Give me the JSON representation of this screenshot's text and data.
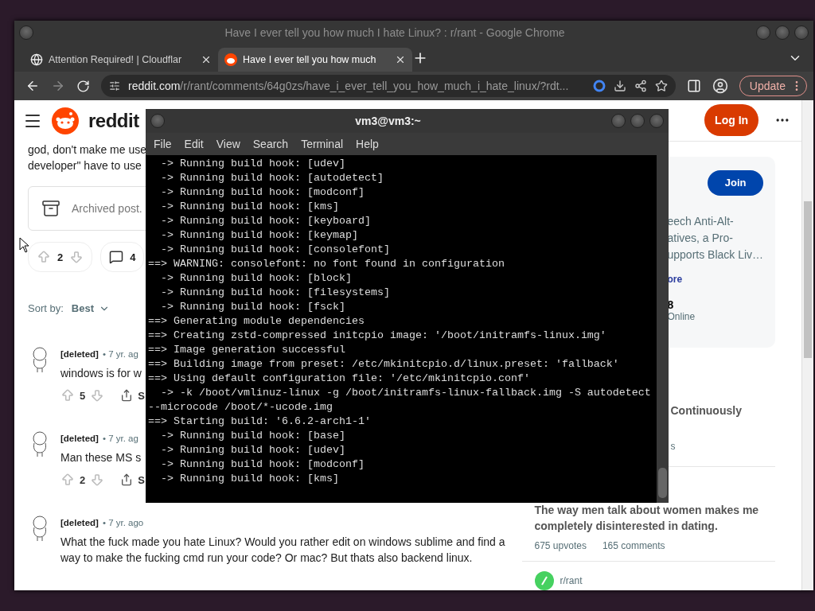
{
  "browser": {
    "title": "Have I ever tell you how much I hate Linux? : r/rant - Google Chrome",
    "tabs": [
      {
        "kind": "globe",
        "label": "Attention Required! | Cloudflar",
        "selected": false
      },
      {
        "kind": "reddit",
        "label": "Have I ever tell you how much",
        "selected": true
      }
    ],
    "url": {
      "host": "reddit.com",
      "path": "/r/rant/comments/64g0zs/have_i_ever_tell_you_how_much_i_hate_linux/?rdt..."
    },
    "update_label": "Update"
  },
  "reddit": {
    "logo": "reddit",
    "login": "Log In",
    "post": {
      "body_lines": [
        "god, don't make me use",
        "developer\" have to use"
      ],
      "archived": "Archived post.",
      "votes": "2",
      "comments": "4"
    },
    "sort": {
      "label": "Sort by:",
      "value": "Best"
    },
    "comments": [
      {
        "author": "[deleted]",
        "age": "• 7 yr. ag",
        "body": "windows is for w",
        "votes": "5",
        "share": "S"
      },
      {
        "author": "[deleted]",
        "age": "• 7 yr. ag",
        "body": "Man these MS s",
        "votes": "2",
        "share": "S"
      },
      {
        "author": "[deleted]",
        "age": "• 7 yr. ago",
        "body": "What the fuck made you hate Linux? Would you rather edit on windows sublime and find a way to make the fucking cmd run your code? Or mac? But thats also backend linux."
      }
    ],
    "sidebar": {
      "join": "Join",
      "description_lines": [
        "eech Anti-Alt-",
        "atives, a Pro-",
        "upports Black Liv…"
      ],
      "more": "ore",
      "members": "8",
      "online": "Online",
      "related": [
        {
          "title": "Continuously",
          "meta": "s"
        },
        {
          "title": "The way men talk about women makes me completely disinterested in dating.",
          "upvotes": "675 upvotes",
          "comments": "165 comments"
        }
      ],
      "next_community": "r/rant"
    }
  },
  "terminal": {
    "title": "vm3@vm3:~",
    "menu": [
      "File",
      "Edit",
      "View",
      "Search",
      "Terminal",
      "Help"
    ],
    "lines": [
      "  -> Running build hook: [udev]",
      "  -> Running build hook: [autodetect]",
      "  -> Running build hook: [modconf]",
      "  -> Running build hook: [kms]",
      "  -> Running build hook: [keyboard]",
      "  -> Running build hook: [keymap]",
      "  -> Running build hook: [consolefont]",
      "==> WARNING: consolefont: no font found in configuration",
      "  -> Running build hook: [block]",
      "  -> Running build hook: [filesystems]",
      "  -> Running build hook: [fsck]",
      "==> Generating module dependencies",
      "==> Creating zstd-compressed initcpio image: '/boot/initramfs-linux.img'",
      "==> Image generation successful",
      "==> Building image from preset: /etc/mkinitcpio.d/linux.preset: 'fallback'",
      "==> Using default configuration file: '/etc/mkinitcpio.conf'",
      "  -> -k /boot/vmlinuz-linux -g /boot/initramfs-linux-fallback.img -S autodetect",
      "--microcode /boot/*-ucode.img",
      "==> Starting build: '6.6.2-arch1-1'",
      "  -> Running build hook: [base]",
      "  -> Running build hook: [udev]",
      "  -> Running build hook: [modconf]",
      "  -> Running build hook: [kms]"
    ]
  }
}
